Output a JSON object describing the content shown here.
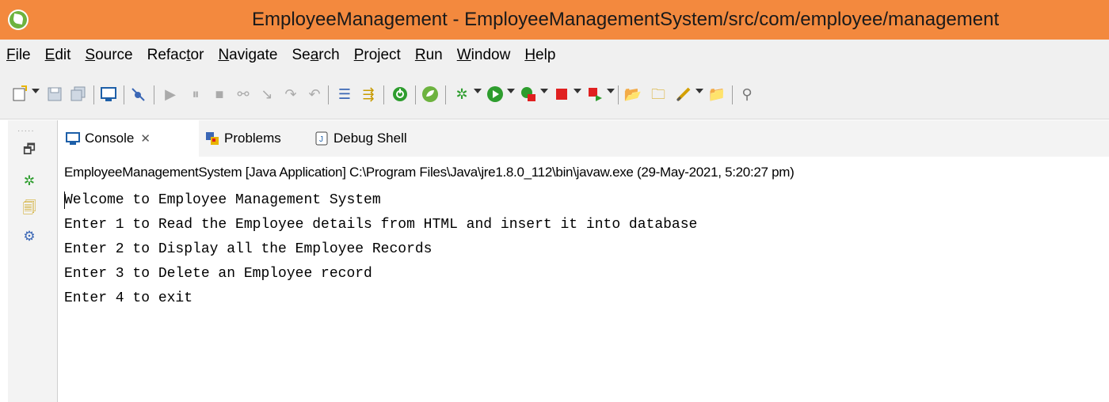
{
  "window": {
    "title": "EmployeeManagement - EmployeeManagementSystem/src/com/employee/management"
  },
  "menu": [
    {
      "label": "File",
      "mnemonic": "F",
      "rest": "ile"
    },
    {
      "label": "Edit",
      "mnemonic": "E",
      "rest": "dit"
    },
    {
      "label": "Source",
      "mnemonic": "S",
      "rest": "ource"
    },
    {
      "label": "Refactor",
      "pre": "Refac",
      "mnemonic": "t",
      "rest": "or"
    },
    {
      "label": "Navigate",
      "mnemonic": "N",
      "rest": "avigate"
    },
    {
      "label": "Search",
      "pre": "Se",
      "mnemonic": "a",
      "rest": "rch"
    },
    {
      "label": "Project",
      "mnemonic": "P",
      "rest": "roject"
    },
    {
      "label": "Run",
      "mnemonic": "R",
      "rest": "un"
    },
    {
      "label": "Window",
      "mnemonic": "W",
      "rest": "indow"
    },
    {
      "label": "Help",
      "mnemonic": "H",
      "rest": "elp"
    }
  ],
  "tabs": {
    "console": "Console",
    "console_close": "✕",
    "problems": "Problems",
    "debug_shell": "Debug Shell"
  },
  "console": {
    "launch_info": "EmployeeManagementSystem [Java Application] C:\\Program Files\\Java\\jre1.8.0_112\\bin\\javaw.exe (29-May-2021, 5:20:27 pm)",
    "lines": [
      "Welcome to Employee Management System",
      "Enter 1 to Read the Employee details from HTML and insert it into database",
      "Enter 2 to Display all the Employee Records",
      "Enter 3 to Delete an Employee record",
      "Enter 4 to exit"
    ]
  },
  "colors": {
    "titlebar": "#f3893e",
    "chrome": "#f0f0f0",
    "spring_green": "#6db33f",
    "run_green": "#2e9d2e",
    "stop_red": "#e02020"
  }
}
